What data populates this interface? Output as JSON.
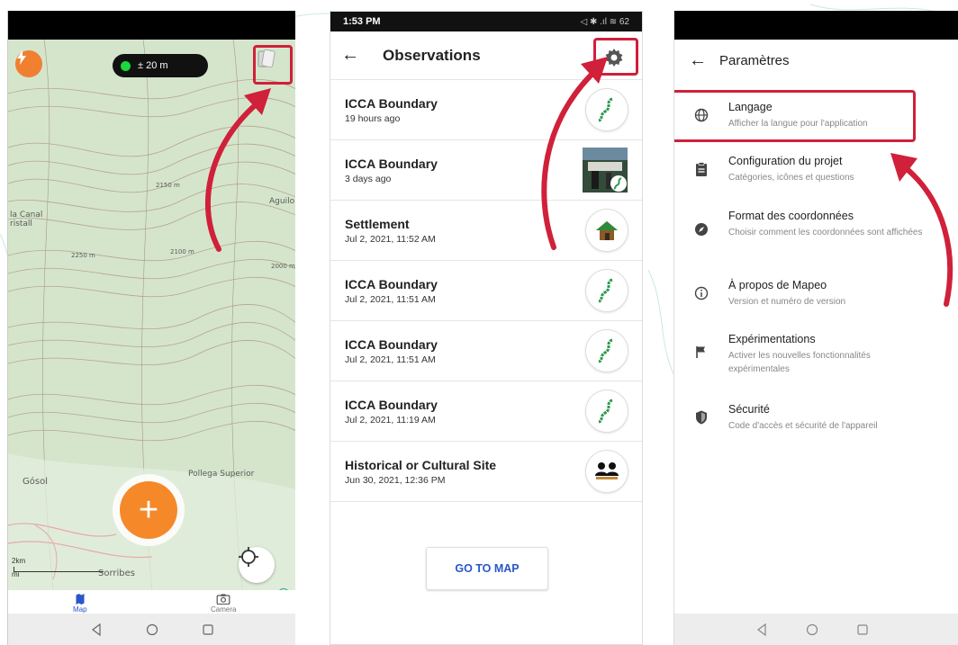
{
  "map_screen": {
    "gps_accuracy": "± 20 m",
    "labels": {
      "la_canal": "la Canal",
      "ristall": "ristall",
      "aguilo": "Aguilo",
      "gosol": "Gósol",
      "pollega": "Pollega Superior",
      "sorribes": "Sorribes",
      "contour_2150": "2150 m",
      "contour_2250": "2250 m",
      "contour_2000": "2000 m",
      "contour_2100": "2100 m"
    },
    "scale_km": "2km",
    "scale_mi": "mi",
    "tabs": [
      {
        "label": "Map"
      },
      {
        "label": "Camera"
      }
    ],
    "accent_color": "#f5892a",
    "highlight_color": "#d0203a"
  },
  "observations_screen": {
    "status_time": "1:53 PM",
    "status_icons": "◁ ✱ .ıl ≋ 62",
    "title": "Observations",
    "items": [
      {
        "title": "ICCA Boundary",
        "time": "19 hours ago",
        "icon": "boundary-icon"
      },
      {
        "title": "ICCA Boundary",
        "time": "3 days ago",
        "icon": "photo-thumbnail"
      },
      {
        "title": "Settlement",
        "time": "Jul 2, 2021, 11:52 AM",
        "icon": "house-icon"
      },
      {
        "title": "ICCA Boundary",
        "time": "Jul 2, 2021, 11:51 AM",
        "icon": "boundary-icon"
      },
      {
        "title": "ICCA Boundary",
        "time": "Jul 2, 2021, 11:51 AM",
        "icon": "boundary-icon"
      },
      {
        "title": "ICCA Boundary",
        "time": "Jul 2, 2021, 11:19 AM",
        "icon": "boundary-icon"
      },
      {
        "title": "Historical or Cultural Site",
        "time": "Jun 30, 2021, 12:36 PM",
        "icon": "people-icon"
      }
    ],
    "goto_map": "GO TO MAP"
  },
  "settings_screen": {
    "title": "Paramètres",
    "items": [
      {
        "title": "Langage",
        "desc": "Afficher la langue pour l'application",
        "icon": "globe-icon"
      },
      {
        "title": "Configuration du projet",
        "desc": "Catégories, icônes et questions",
        "icon": "clipboard-icon"
      },
      {
        "title": "Format des coordonnées",
        "desc": "Choisir comment les coordonnées sont affichées",
        "icon": "compass-icon"
      },
      {
        "title": "À propos de Mapeo",
        "desc": "Version et numéro de version",
        "icon": "info-icon"
      },
      {
        "title": "Expérimentations",
        "desc": "Activer les nouvelles fonctionnalités expérimentales",
        "icon": "flag-icon"
      },
      {
        "title": "Sécurité",
        "desc": "Code d'accès et sécurité de l'appareil",
        "icon": "shield-icon"
      }
    ]
  }
}
